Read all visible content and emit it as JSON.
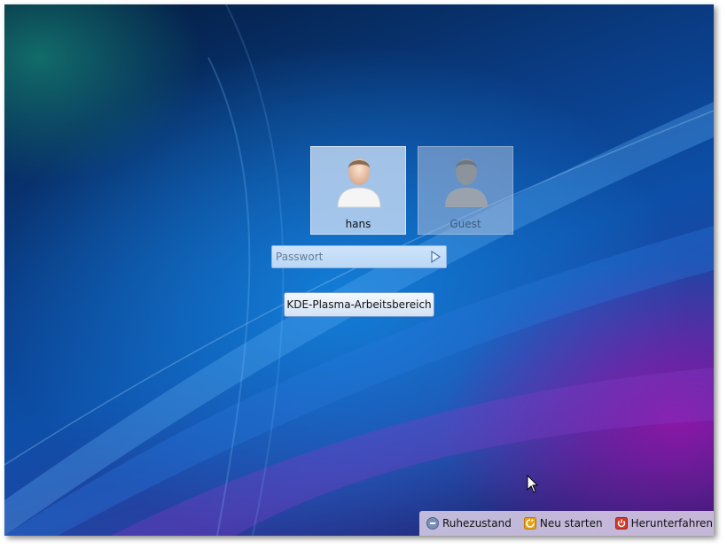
{
  "users": [
    {
      "name": "hans",
      "selected": true
    },
    {
      "name": "Guest",
      "selected": false
    }
  ],
  "password": {
    "placeholder": "Passwort",
    "value": ""
  },
  "session": {
    "label": "KDE-Plasma-Arbeitsbereich"
  },
  "power": {
    "suspend_label": "Ruhezustand",
    "restart_label": "Neu starten",
    "shutdown_label": "Herunterfahren"
  },
  "icons": {
    "user": "user-avatar-icon",
    "submit": "arrow-right-icon",
    "suspend": "suspend-icon",
    "restart": "restart-icon",
    "shutdown": "shutdown-icon",
    "cursor": "mouse-pointer-icon"
  },
  "colors": {
    "suspend_icon": "#7a8fb8",
    "restart_icon": "#e8a317",
    "shutdown_icon": "#d23a2a"
  }
}
